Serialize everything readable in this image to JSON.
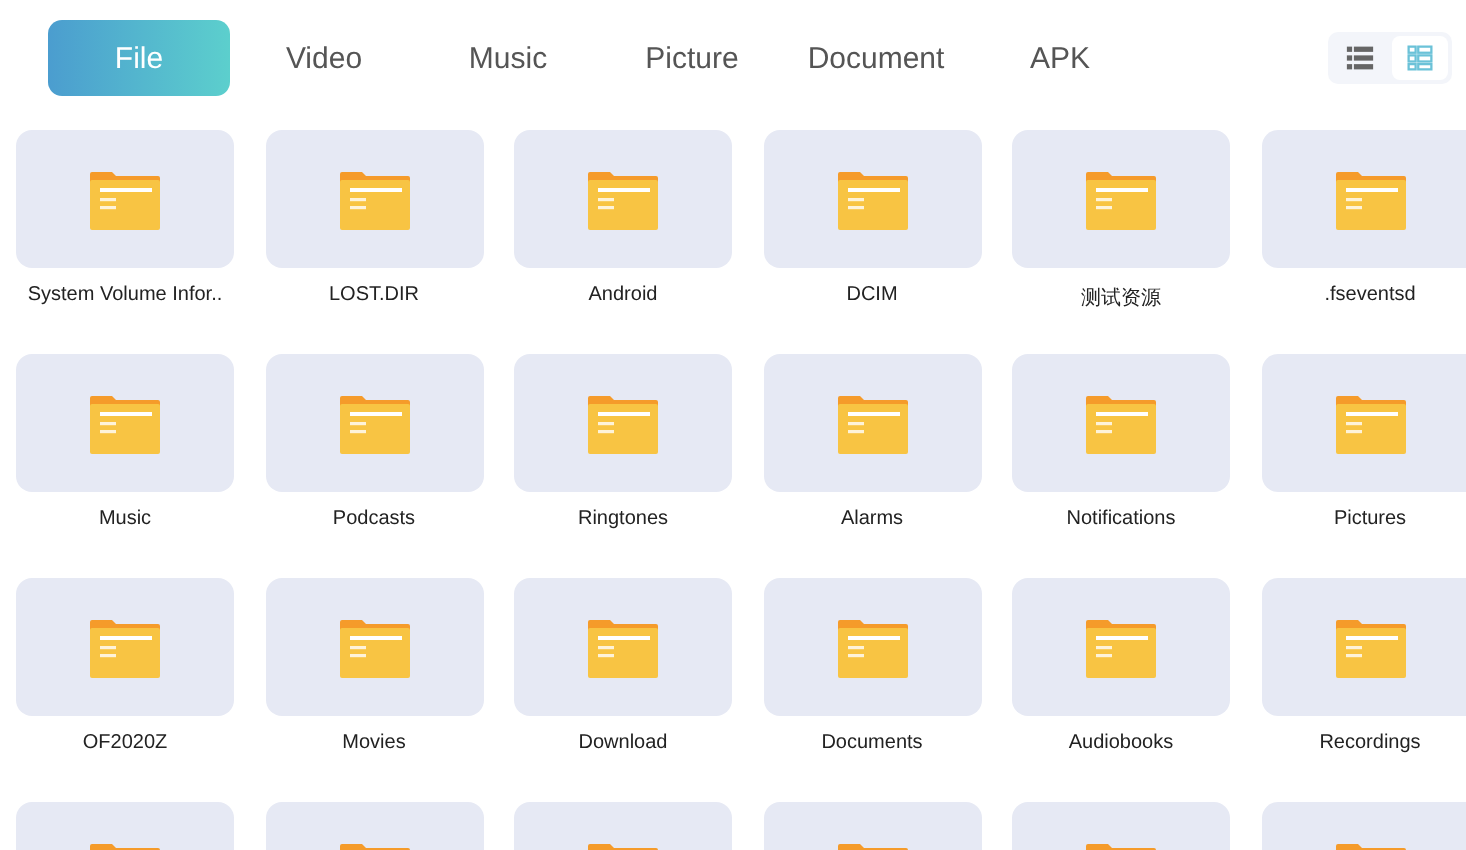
{
  "tabs": [
    {
      "label": "File",
      "selected": true
    },
    {
      "label": "Video",
      "selected": false
    },
    {
      "label": "Music",
      "selected": false
    },
    {
      "label": "Picture",
      "selected": false
    },
    {
      "label": "Document",
      "selected": false
    },
    {
      "label": "APK",
      "selected": false
    }
  ],
  "view_toggle": [
    {
      "kind": "list",
      "selected": false
    },
    {
      "kind": "grid",
      "selected": true
    }
  ],
  "folders": [
    {
      "kind": "folder",
      "name": "System Volume Infor.."
    },
    {
      "kind": "folder",
      "name": "LOST.DIR"
    },
    {
      "kind": "folder",
      "name": "Android"
    },
    {
      "kind": "folder",
      "name": "DCIM"
    },
    {
      "kind": "folder",
      "name": "测试资源"
    },
    {
      "kind": "folder",
      "name": ".fseventsd"
    },
    {
      "kind": "folder",
      "name": "Music"
    },
    {
      "kind": "folder",
      "name": "Podcasts"
    },
    {
      "kind": "folder",
      "name": "Ringtones"
    },
    {
      "kind": "folder",
      "name": "Alarms"
    },
    {
      "kind": "folder",
      "name": "Notifications"
    },
    {
      "kind": "folder",
      "name": "Pictures"
    },
    {
      "kind": "folder",
      "name": "OF2020Z"
    },
    {
      "kind": "folder",
      "name": "Movies"
    },
    {
      "kind": "folder",
      "name": "Download"
    },
    {
      "kind": "folder",
      "name": "Documents"
    },
    {
      "kind": "folder",
      "name": "Audiobooks"
    },
    {
      "kind": "folder",
      "name": "Recordings"
    },
    {
      "kind": "folder"
    },
    {
      "kind": "folder"
    },
    {
      "kind": "folder"
    },
    {
      "kind": "folder"
    },
    {
      "kind": "folder"
    },
    {
      "kind": "folder"
    }
  ]
}
